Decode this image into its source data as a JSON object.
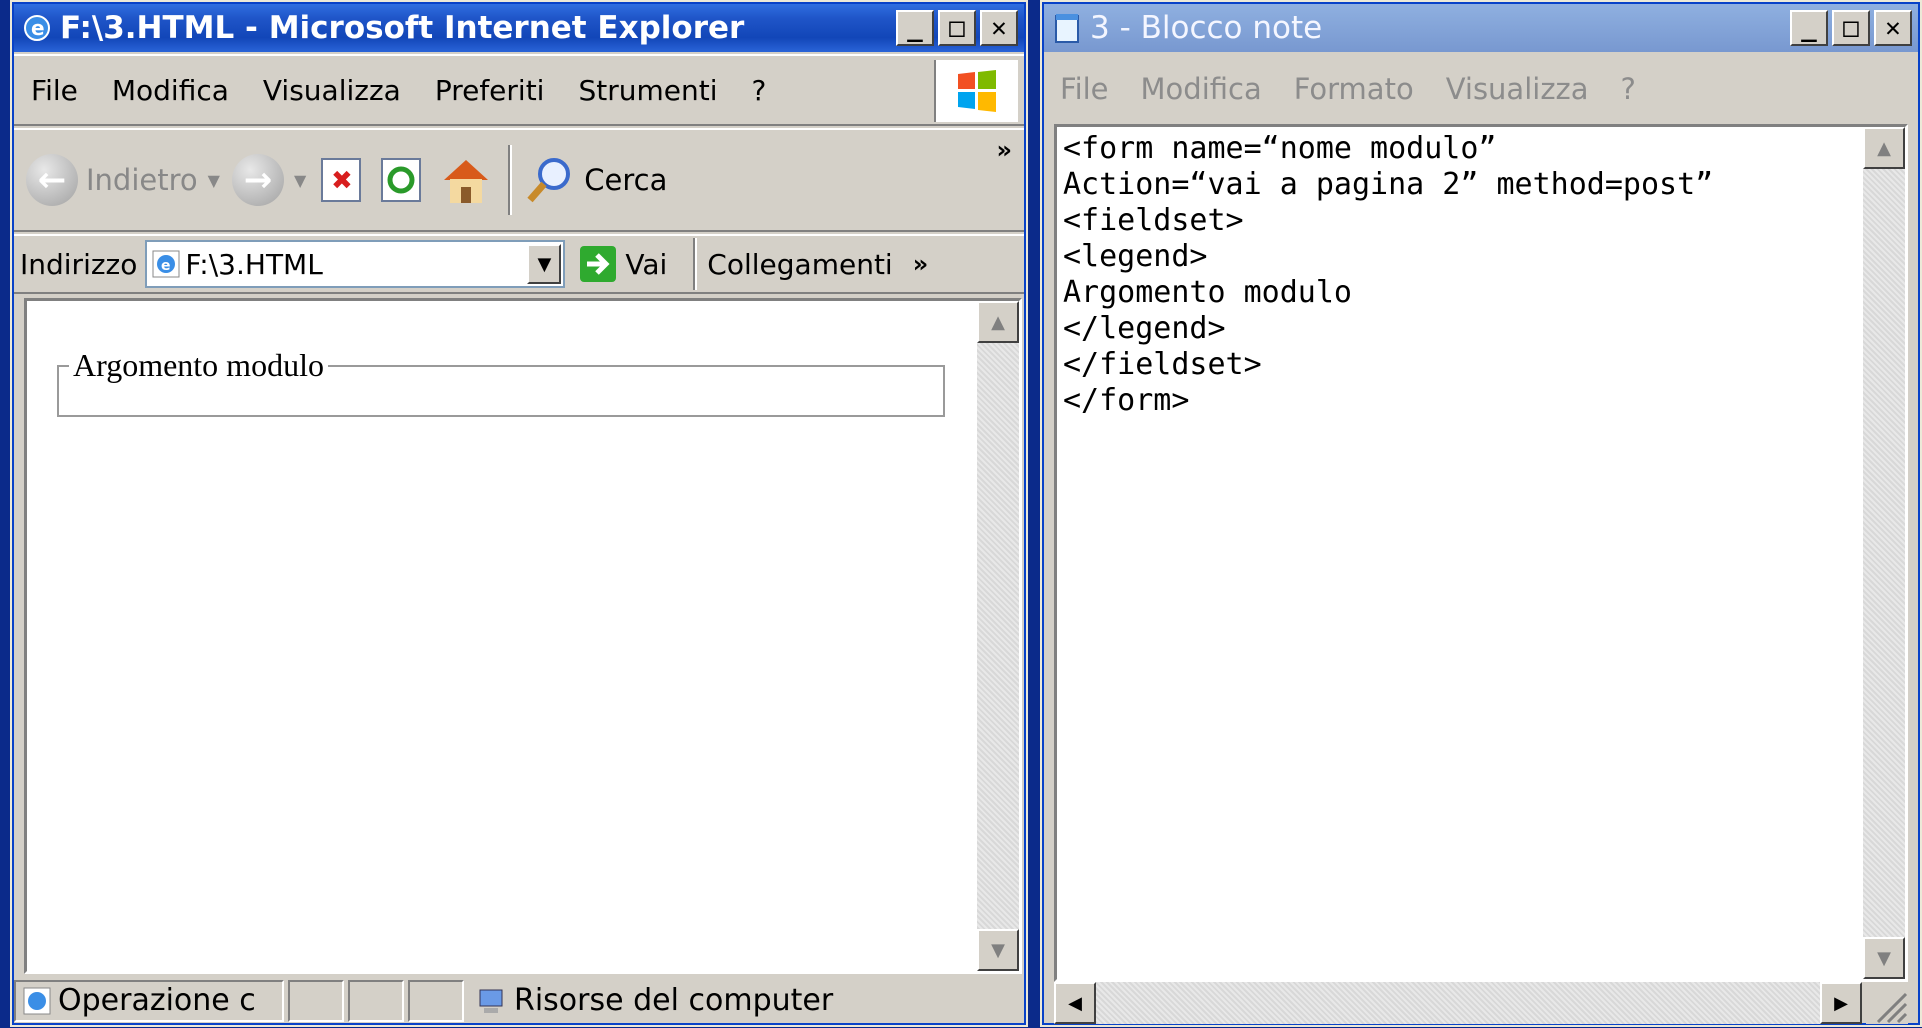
{
  "ie": {
    "title": "F:\\3.HTML - Microsoft Internet Explorer",
    "menu": [
      "File",
      "Modifica",
      "Visualizza",
      "Preferiti",
      "Strumenti",
      "?"
    ],
    "toolbar": {
      "back": "Indietro",
      "search": "Cerca"
    },
    "address": {
      "label": "Indirizzo",
      "value": "F:\\3.HTML",
      "go": "Vai",
      "links": "Collegamenti"
    },
    "page": {
      "legend": "Argomento modulo"
    },
    "status": {
      "text": "Operazione c",
      "zone": "Risorse del computer"
    }
  },
  "notepad": {
    "title": "3 - Blocco note",
    "menu": [
      "File",
      "Modifica",
      "Formato",
      "Visualizza",
      "?"
    ],
    "content": "<form name=“nome modulo”\nAction=“vai a pagina 2” method=post”\n<fieldset>\n<legend>\nArgomento modulo\n</legend>\n</fieldset>\n</form>"
  },
  "colors": {
    "title_active": "#1f55c8",
    "title_inactive": "#7898d0",
    "chrome": "#d4d0c8"
  }
}
